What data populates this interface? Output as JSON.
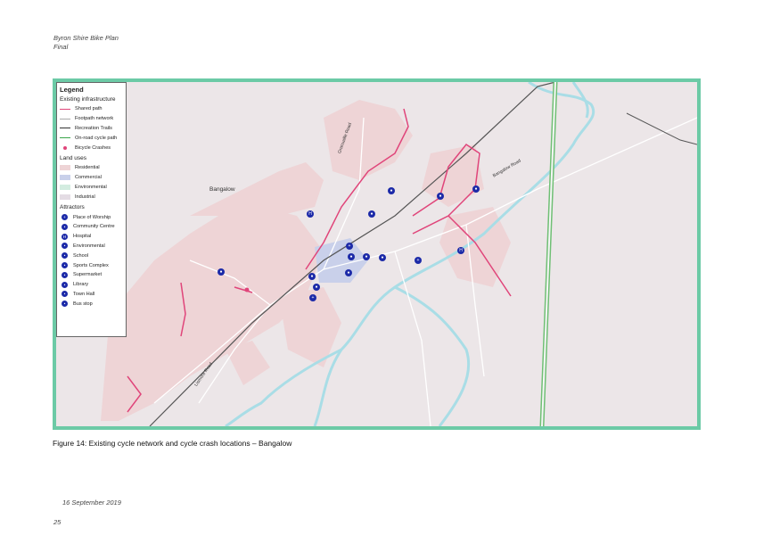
{
  "header": {
    "line1": "Byron Shire Bike Plan",
    "line2": "Final"
  },
  "map": {
    "town_label": "Bangalow",
    "road_labels": [
      "Granuaille Road",
      "Bangalow Road",
      "Lismore Road"
    ],
    "colors": {
      "frame": "#6ccaa6",
      "shared_path": "#e0457a",
      "rail": "#555555",
      "creek": "#a9dde6",
      "residential": "#eed4d6",
      "commercial": "#c9d0ea",
      "motorway": "#6fbf74",
      "icon": "#1c2aa8"
    }
  },
  "legend": {
    "title": "Legend",
    "infra_heading": "Existing infrastructure",
    "infra": [
      {
        "label": "Shared path",
        "color": "#e0457a"
      },
      {
        "label": "Footpath network",
        "color": "#aaaaaa"
      },
      {
        "label": "Recreation Trails",
        "color": "#333333"
      },
      {
        "label": "On-road cycle path",
        "color": "#3aa64a"
      }
    ],
    "crash_label": "Bicycle Crashes",
    "landuse_heading": "Land uses",
    "landuses": [
      {
        "label": "Residential",
        "color": "#eed4d6"
      },
      {
        "label": "Commercial",
        "color": "#c9d0ea"
      },
      {
        "label": "Environmental",
        "color": "#d3ece0"
      },
      {
        "label": "Industrial",
        "color": "#e4dce4"
      }
    ],
    "attractors_heading": "Attractors",
    "attractors": [
      {
        "label": "Place of Worship",
        "icon": "cross-icon"
      },
      {
        "label": "Community Centre",
        "icon": "community-icon"
      },
      {
        "label": "Hospital",
        "icon": "hospital-icon"
      },
      {
        "label": "Environmental",
        "icon": "leaf-icon"
      },
      {
        "label": "School",
        "icon": "school-icon"
      },
      {
        "label": "Sports Complex",
        "icon": "sports-icon"
      },
      {
        "label": "Supermarket",
        "icon": "cart-icon"
      },
      {
        "label": "Library",
        "icon": "book-icon"
      },
      {
        "label": "Town Hall",
        "icon": "hall-icon"
      },
      {
        "label": "Bus stop",
        "icon": "bus-icon"
      }
    ]
  },
  "caption": "Figure 14: Existing cycle network and cycle crash locations – Bangalow",
  "footer": {
    "date": "16 September 2019",
    "page": "25"
  }
}
